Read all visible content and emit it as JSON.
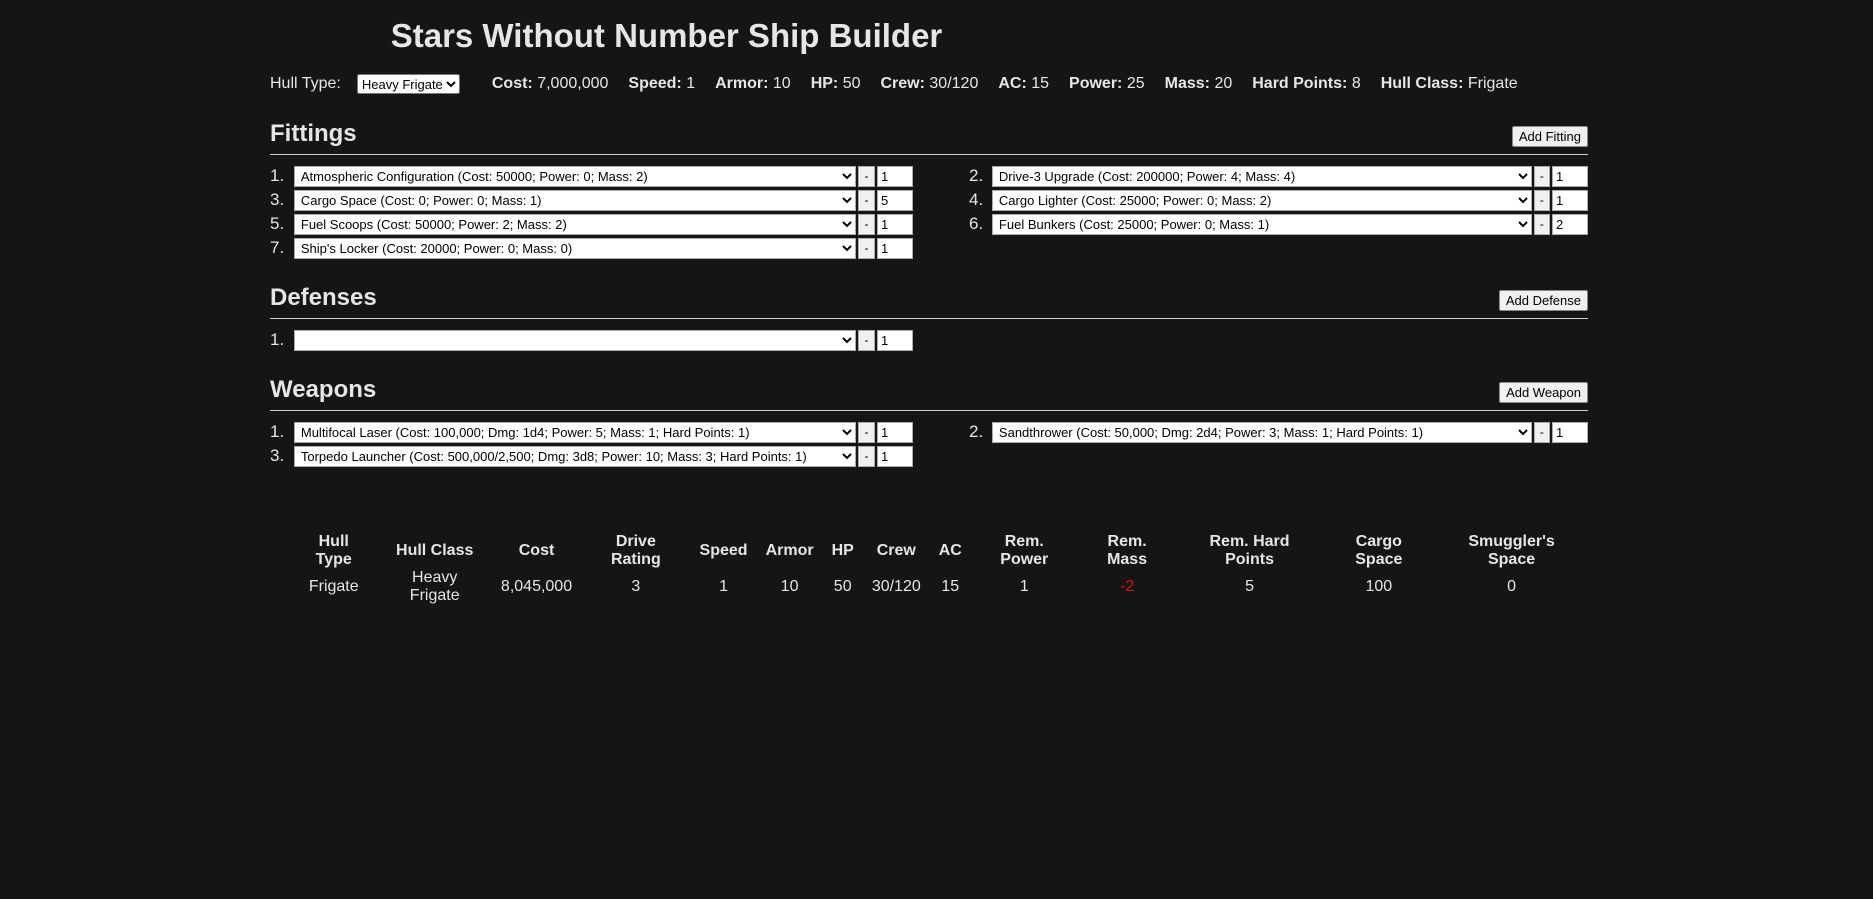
{
  "title": "Stars Without Number Ship Builder",
  "hull": {
    "label": "Hull Type:",
    "selected": "Heavy Frigate",
    "stats": [
      {
        "label": "Cost:",
        "value": "7,000,000"
      },
      {
        "label": "Speed:",
        "value": "1"
      },
      {
        "label": "Armor:",
        "value": "10"
      },
      {
        "label": "HP:",
        "value": "50"
      },
      {
        "label": "Crew:",
        "value": "30/120"
      },
      {
        "label": "AC:",
        "value": "15"
      },
      {
        "label": "Power:",
        "value": "25"
      },
      {
        "label": "Mass:",
        "value": "20"
      },
      {
        "label": "Hard Points:",
        "value": "8"
      },
      {
        "label": "Hull Class:",
        "value": "Frigate"
      }
    ]
  },
  "fittings": {
    "title": "Fittings",
    "add_label": "Add Fitting",
    "items": [
      {
        "num": "1.",
        "value": "Atmospheric Configuration (Cost: 50000; Power: 0; Mass: 2)",
        "qty": "1"
      },
      {
        "num": "2.",
        "value": "Drive-3 Upgrade (Cost: 200000; Power: 4; Mass: 4)",
        "qty": "1"
      },
      {
        "num": "3.",
        "value": "Cargo Space (Cost: 0; Power: 0; Mass: 1)",
        "qty": "5"
      },
      {
        "num": "4.",
        "value": "Cargo Lighter (Cost: 25000; Power: 0; Mass: 2)",
        "qty": "1"
      },
      {
        "num": "5.",
        "value": "Fuel Scoops (Cost: 50000; Power: 2; Mass: 2)",
        "qty": "1"
      },
      {
        "num": "6.",
        "value": "Fuel Bunkers (Cost: 25000; Power: 0; Mass: 1)",
        "qty": "2"
      },
      {
        "num": "7.",
        "value": "Ship's Locker (Cost: 20000; Power: 0; Mass: 0)",
        "qty": "1"
      }
    ]
  },
  "defenses": {
    "title": "Defenses",
    "add_label": "Add Defense",
    "items": [
      {
        "num": "1.",
        "value": "",
        "qty": "1"
      }
    ]
  },
  "weapons": {
    "title": "Weapons",
    "add_label": "Add Weapon",
    "items": [
      {
        "num": "1.",
        "value": "Multifocal Laser (Cost: 100,000; Dmg: 1d4; Power: 5; Mass: 1; Hard Points: 1)",
        "qty": "1"
      },
      {
        "num": "2.",
        "value": "Sandthrower (Cost: 50,000; Dmg: 2d4; Power: 3; Mass: 1; Hard Points: 1)",
        "qty": "1"
      },
      {
        "num": "3.",
        "value": "Torpedo Launcher (Cost: 500,000/2,500; Dmg: 3d8; Power: 10; Mass: 3; Hard Points: 1)",
        "qty": "1"
      }
    ]
  },
  "minus_label": "-",
  "summary": {
    "headers": [
      "Hull Type",
      "Hull Class",
      "Cost",
      "Drive Rating",
      "Speed",
      "Armor",
      "HP",
      "Crew",
      "AC",
      "Rem. Power",
      "Rem. Mass",
      "Rem. Hard Points",
      "Cargo Space",
      "Smuggler's Space"
    ],
    "values": [
      "Frigate",
      "Heavy Frigate",
      "8,045,000",
      "3",
      "1",
      "10",
      "50",
      "30/120",
      "15",
      "1",
      "-2",
      "5",
      "100",
      "0"
    ]
  },
  "colors": {
    "background": "#151515",
    "text": "#e6e6e6",
    "negative": "#e01010"
  }
}
